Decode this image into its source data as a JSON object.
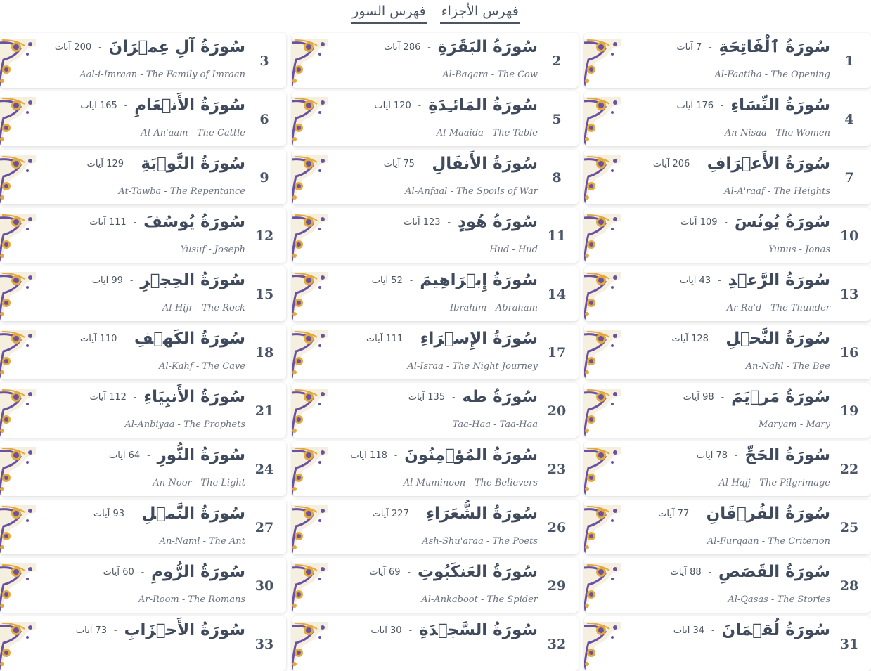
{
  "nav": {
    "juz_index": "فهرس الأجزاء",
    "surah_index": "فهرس السور"
  },
  "verses_word": "آيات",
  "colors": {
    "ornament_gold": "#e4a93a",
    "ornament_purple": "#6a52a3",
    "text": "#4a5568"
  },
  "surahs": [
    {
      "num": "1",
      "ar": "سُورَةُ ٱلْفَاتِحَةِ",
      "ayat": "7",
      "en": "Al-Faatiha - The Opening"
    },
    {
      "num": "2",
      "ar": "سُورَةُ البَقَرَةِ",
      "ayat": "286",
      "en": "Al-Baqara - The Cow"
    },
    {
      "num": "3",
      "ar": "سُورَةُ آلِ عِمۡرَانَ",
      "ayat": "200",
      "en": "Aal-i-Imraan - The Family of Imraan"
    },
    {
      "num": "4",
      "ar": "سُورَةُ النِّسَاءِ",
      "ayat": "176",
      "en": "An-Nisaa - The Women"
    },
    {
      "num": "5",
      "ar": "سُورَةُ المَائـِدَةِ",
      "ayat": "120",
      "en": "Al-Maaida - The Table"
    },
    {
      "num": "6",
      "ar": "سُورَةُ الأَنۡعَامِ",
      "ayat": "165",
      "en": "Al-An'aam - The Cattle"
    },
    {
      "num": "7",
      "ar": "سُورَةُ الأَعۡرَافِ",
      "ayat": "206",
      "en": "Al-A'raaf - The Heights"
    },
    {
      "num": "8",
      "ar": "سُورَةُ الأَنفَالِ",
      "ayat": "75",
      "en": "Al-Anfaal - The Spoils of War"
    },
    {
      "num": "9",
      "ar": "سُورَةُ التَّوۡبَةِ",
      "ayat": "129",
      "en": "At-Tawba - The Repentance"
    },
    {
      "num": "10",
      "ar": "سُورَةُ يُونُسَ",
      "ayat": "109",
      "en": "Yunus - Jonas"
    },
    {
      "num": "11",
      "ar": "سُورَةُ هُودٍ",
      "ayat": "123",
      "en": "Hud - Hud"
    },
    {
      "num": "12",
      "ar": "سُورَةُ يُوسُفَ",
      "ayat": "111",
      "en": "Yusuf - Joseph"
    },
    {
      "num": "13",
      "ar": "سُورَةُ الرَّعۡدِ",
      "ayat": "43",
      "en": "Ar-Ra'd - The Thunder"
    },
    {
      "num": "14",
      "ar": "سُورَةُ إِبۡرَاهِيمَ",
      "ayat": "52",
      "en": "Ibrahim - Abraham"
    },
    {
      "num": "15",
      "ar": "سُورَةُ الحِجۡرِ",
      "ayat": "99",
      "en": "Al-Hijr - The Rock"
    },
    {
      "num": "16",
      "ar": "سُورَةُ النَّحۡلِ",
      "ayat": "128",
      "en": "An-Nahl - The Bee"
    },
    {
      "num": "17",
      "ar": "سُورَةُ الإِسۡرَاءِ",
      "ayat": "111",
      "en": "Al-Israa - The Night Journey"
    },
    {
      "num": "18",
      "ar": "سُورَةُ الكَهۡفِ",
      "ayat": "110",
      "en": "Al-Kahf - The Cave"
    },
    {
      "num": "19",
      "ar": "سُورَةُ مَرۡيَمَ",
      "ayat": "98",
      "en": "Maryam - Mary"
    },
    {
      "num": "20",
      "ar": "سُورَةُ طه",
      "ayat": "135",
      "en": "Taa-Haa - Taa-Haa"
    },
    {
      "num": "21",
      "ar": "سُورَةُ الأَنبِيَاءِ",
      "ayat": "112",
      "en": "Al-Anbiyaa - The Prophets"
    },
    {
      "num": "22",
      "ar": "سُورَةُ الحَجِّ",
      "ayat": "78",
      "en": "Al-Hajj - The Pilgrimage"
    },
    {
      "num": "23",
      "ar": "سُورَةُ المُؤۡمِنُونَ",
      "ayat": "118",
      "en": "Al-Muminoon - The Believers"
    },
    {
      "num": "24",
      "ar": "سُورَةُ النُّورِ",
      "ayat": "64",
      "en": "An-Noor - The Light"
    },
    {
      "num": "25",
      "ar": "سُورَةُ الفُرۡقَانِ",
      "ayat": "77",
      "en": "Al-Furqaan - The Criterion"
    },
    {
      "num": "26",
      "ar": "سُورَةُ الشُّعَرَاءِ",
      "ayat": "227",
      "en": "Ash-Shu'araa - The Poets"
    },
    {
      "num": "27",
      "ar": "سُورَةُ النَّمۡلِ",
      "ayat": "93",
      "en": "An-Naml - The Ant"
    },
    {
      "num": "28",
      "ar": "سُورَةُ القَصَصِ",
      "ayat": "88",
      "en": "Al-Qasas - The Stories"
    },
    {
      "num": "29",
      "ar": "سُورَةُ العَنكَبُوتِ",
      "ayat": "69",
      "en": "Al-Ankaboot - The Spider"
    },
    {
      "num": "30",
      "ar": "سُورَةُ الرُّومِ",
      "ayat": "60",
      "en": "Ar-Room - The Romans"
    },
    {
      "num": "31",
      "ar": "سُورَةُ لُقۡمَانَ",
      "ayat": "34",
      "en": ""
    },
    {
      "num": "32",
      "ar": "سُورَةُ السَّجۡدَةِ",
      "ayat": "30",
      "en": ""
    },
    {
      "num": "33",
      "ar": "سُورَةُ الأَحۡزَابِ",
      "ayat": "73",
      "en": ""
    }
  ]
}
